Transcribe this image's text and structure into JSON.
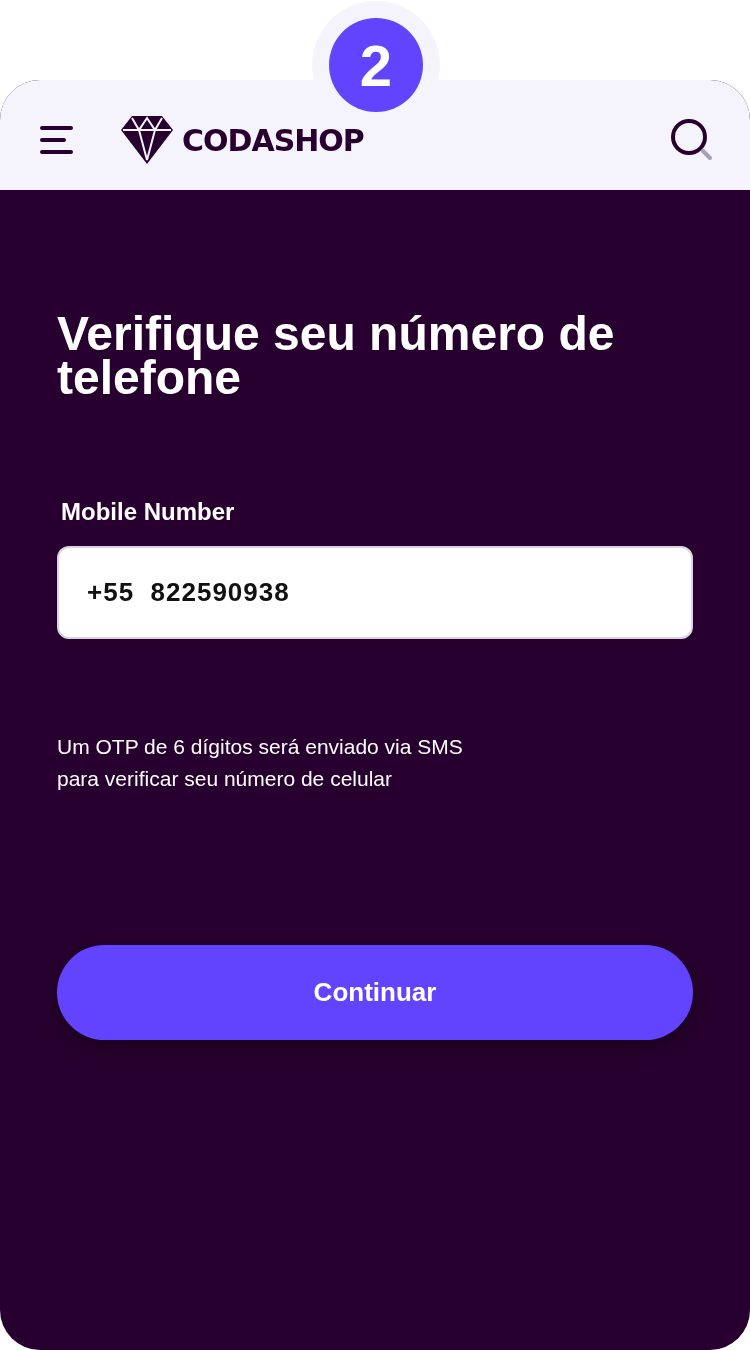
{
  "step_badge": "2",
  "header": {
    "logo_text": "CODASHOP"
  },
  "title": "Verifique seu número de telefone",
  "mobile_field": {
    "label": "Mobile Number",
    "value": "+55  822590938"
  },
  "helper_text": [
    "Um OTP de 6 dígitos será enviado via SMS",
    "para verificar seu número de celular"
  ],
  "continue_button": "Continuar"
}
